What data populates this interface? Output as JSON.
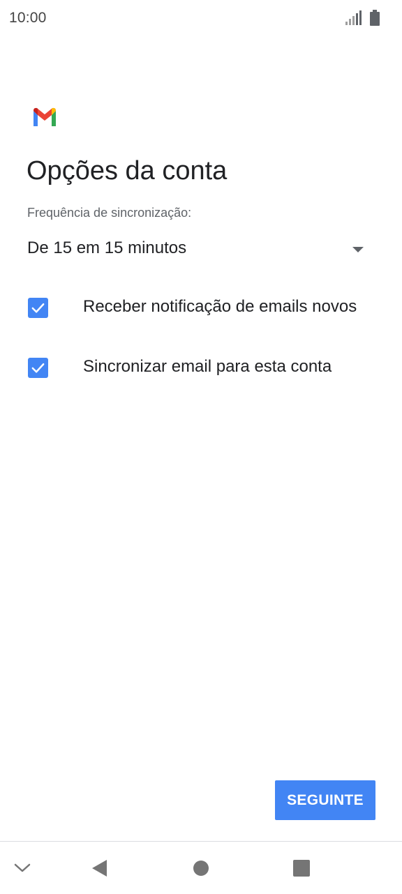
{
  "status_bar": {
    "time": "10:00",
    "icons": [
      "signal-icon",
      "battery-icon"
    ]
  },
  "header": {
    "logo_icon": "gmail-logo-icon",
    "title": "Opções da conta"
  },
  "sync": {
    "label": "Frequência de sincronização:",
    "selected_value": "De 15 em 15 minutos"
  },
  "options": [
    {
      "label": "Receber notificação de emails novos",
      "checked": true
    },
    {
      "label": "Sincronizar email para esta conta",
      "checked": true
    }
  ],
  "actions": {
    "next_label": "SEGUINTE"
  },
  "nav_bar": {
    "icons": [
      "collapse-icon",
      "back-icon",
      "home-icon",
      "recents-icon"
    ]
  },
  "colors": {
    "accent": "#4285f4",
    "text_primary": "#202124",
    "text_secondary": "#5f6368"
  }
}
